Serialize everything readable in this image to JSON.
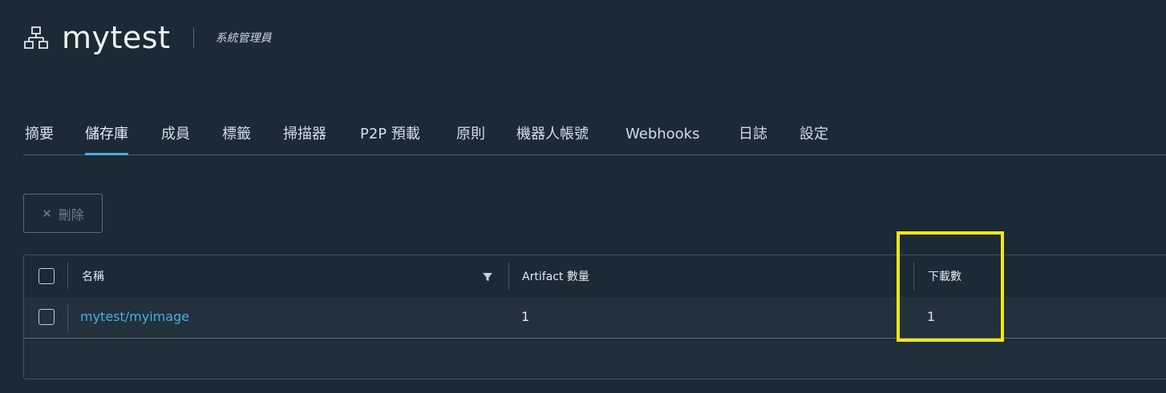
{
  "header": {
    "project_icon": "project-hierarchy-icon",
    "project_name": "mytest",
    "role": "系統管理員"
  },
  "tabs": [
    {
      "label": "摘要",
      "active": false
    },
    {
      "label": "儲存庫",
      "active": true
    },
    {
      "label": "成員",
      "active": false
    },
    {
      "label": "標籤",
      "active": false
    },
    {
      "label": "掃描器",
      "active": false
    },
    {
      "label": "P2P 預載",
      "active": false
    },
    {
      "label": "原則",
      "active": false
    },
    {
      "label": "機器人帳號",
      "active": false
    },
    {
      "label": "Webhooks",
      "active": false
    },
    {
      "label": "日誌",
      "active": false
    },
    {
      "label": "設定",
      "active": false
    }
  ],
  "toolbar": {
    "delete_icon": "close-icon",
    "delete_label": "刪除",
    "delete_enabled": false
  },
  "grid": {
    "columns": [
      "名稱",
      "Artifact 數量",
      "下載數"
    ],
    "filter_icon": "filter-icon",
    "rows": [
      {
        "name": "mytest/myimage",
        "artifact_count": "1",
        "downloads": "1"
      }
    ]
  },
  "colors": {
    "background": "#1b2a36",
    "accent": "#49afd9",
    "highlight": "#f5e60c"
  }
}
